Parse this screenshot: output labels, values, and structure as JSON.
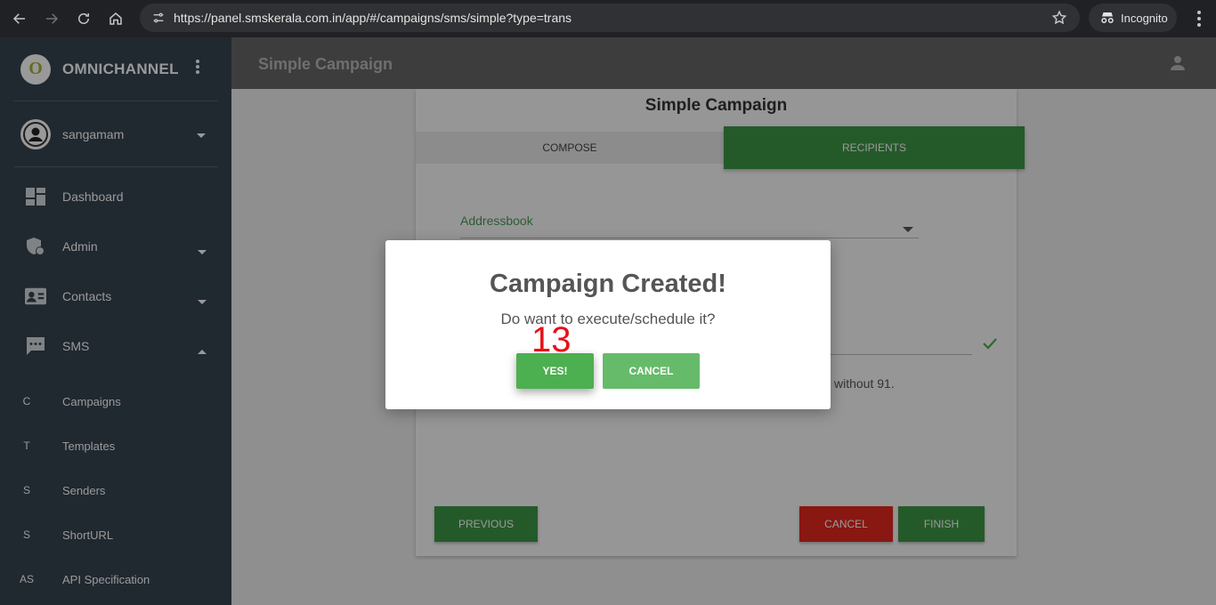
{
  "browser": {
    "url": "https://panel.smskerala.com.in/app/#/campaigns/sms/simple?type=trans",
    "incognito_label": "Incognito"
  },
  "sidebar": {
    "logo_letter": "O",
    "brand": "OMNICHANNEL",
    "user": "sangamam",
    "items": [
      {
        "label": "Dashboard",
        "icon": "dashboard-icon"
      },
      {
        "label": "Admin",
        "icon": "admin-shield-icon"
      },
      {
        "label": "Contacts",
        "icon": "contacts-icon"
      },
      {
        "label": "SMS",
        "icon": "sms-icon"
      }
    ],
    "sms_sub": [
      {
        "abbr": "C",
        "label": "Campaigns"
      },
      {
        "abbr": "T",
        "label": "Templates"
      },
      {
        "abbr": "S",
        "label": "Senders"
      },
      {
        "abbr": "S",
        "label": "ShortURL"
      },
      {
        "abbr": "AS",
        "label": "API Specification"
      }
    ]
  },
  "header": {
    "title": "Simple Campaign"
  },
  "card": {
    "title": "Simple Campaign",
    "tabs": [
      "COMPOSE",
      "RECIPIENTS"
    ],
    "addressbook_label": "Addressbook",
    "hint_text": "without 91.",
    "buttons": {
      "previous": "PREVIOUS",
      "cancel": "CANCEL",
      "finish": "FINISH"
    }
  },
  "modal": {
    "title": "Campaign Created!",
    "text": "Do want to execute/schedule it?",
    "yes": "YES!",
    "cancel": "CANCEL",
    "step_number": "13"
  },
  "colors": {
    "sidebar_bg": "#364450",
    "primary_green": "#3d9645",
    "danger_red": "#e5271f",
    "step_red": "#e8111a"
  }
}
